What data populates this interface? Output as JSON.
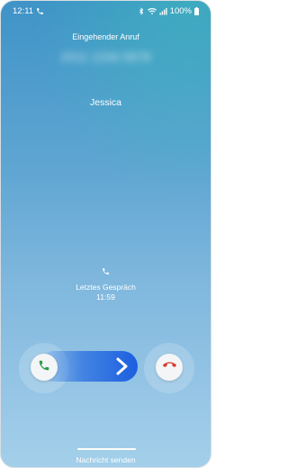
{
  "status_bar": {
    "time": "12:11",
    "battery": "100%",
    "icons": [
      "phone-icon",
      "bluetooth-icon",
      "wifi-icon",
      "signal-icon",
      "battery-icon"
    ]
  },
  "call": {
    "header": "Eingehender Anruf",
    "number_blurred": "2011 1234 5678",
    "caller_name": "Jessica"
  },
  "last_call": {
    "label": "Letztes Gespräch",
    "time": "11:59"
  },
  "actions": {
    "accept_icon": "phone-accept-icon",
    "decline_icon": "phone-decline-icon",
    "slide_icon": "chevron-right-icon",
    "message": "Nachricht senden"
  },
  "colors": {
    "accept": "#2e9b4a",
    "decline": "#d93a2f",
    "slider": "#1c5fe0"
  }
}
